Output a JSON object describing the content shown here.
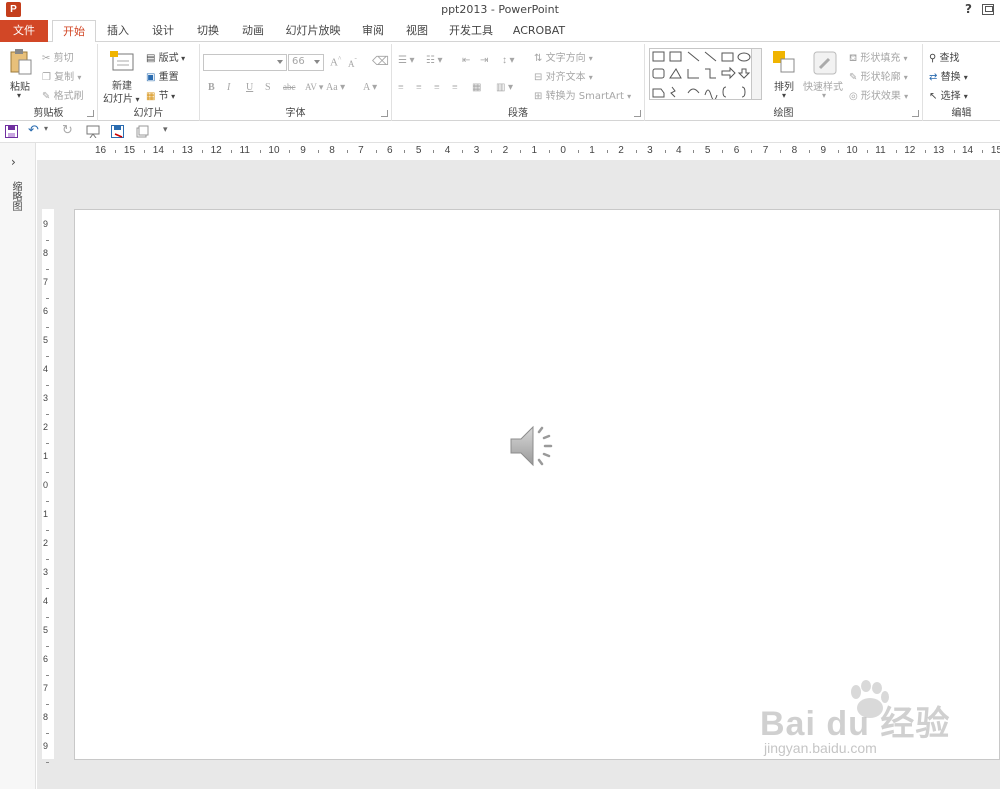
{
  "window": {
    "title": "ppt2013 - PowerPoint",
    "app_logo": "P",
    "help": "?"
  },
  "tabs": [
    {
      "label": "文件"
    },
    {
      "label": "开始"
    },
    {
      "label": "插入"
    },
    {
      "label": "设计"
    },
    {
      "label": "切换"
    },
    {
      "label": "动画"
    },
    {
      "label": "幻灯片放映"
    },
    {
      "label": "审阅"
    },
    {
      "label": "视图"
    },
    {
      "label": "开发工具"
    },
    {
      "label": "ACROBAT"
    }
  ],
  "ribbon": {
    "clipboard": {
      "label": "剪贴板",
      "paste": "粘贴",
      "cut": "剪切",
      "copy": "复制",
      "format_painter": "格式刷"
    },
    "slides": {
      "label": "幻灯片",
      "new_slide_1": "新建",
      "new_slide_2": "幻灯片",
      "layout": "版式",
      "reset": "重置",
      "section": "节"
    },
    "font": {
      "label": "字体",
      "font_size": "66",
      "bold": "B",
      "italic": "I",
      "underline": "U",
      "shadow": "S",
      "strike": "abc",
      "case": "Aa",
      "font_color": "A",
      "grow": "A",
      "shrink": "A"
    },
    "paragraph": {
      "label": "段落",
      "text_direction": "文字方向",
      "align_text": "对齐文本",
      "smartart": "转换为 SmartArt"
    },
    "drawing": {
      "label": "绘图",
      "arrange": "排列",
      "quick_styles": "快速样式",
      "shape_fill": "形状填充",
      "shape_outline": "形状轮廓",
      "shape_effects": "形状效果"
    },
    "editing": {
      "label": "编辑",
      "find": "查找",
      "replace": "替换",
      "select": "选择"
    }
  },
  "left_pane": {
    "label": "缩略图"
  },
  "ruler": {
    "h": [
      "16",
      "15",
      "14",
      "13",
      "12",
      "11",
      "10",
      "9",
      "8",
      "7",
      "6",
      "5",
      "4",
      "3",
      "2",
      "1",
      "0",
      "1",
      "2",
      "3",
      "4",
      "5",
      "6",
      "7",
      "8",
      "9",
      "10",
      "11",
      "12",
      "13",
      "14",
      "15"
    ],
    "v": [
      "9",
      "8",
      "7",
      "6",
      "5",
      "4",
      "3",
      "2",
      "1",
      "0",
      "1",
      "2",
      "3",
      "4",
      "5",
      "6",
      "7",
      "8",
      "9"
    ]
  },
  "watermark": {
    "brand": "Bai du 经验",
    "url": "jingyan.baidu.com"
  },
  "colors": {
    "accent": "#d24726",
    "ribbon_bg": "#ffffff",
    "workspace_bg": "#e8e8e8"
  }
}
